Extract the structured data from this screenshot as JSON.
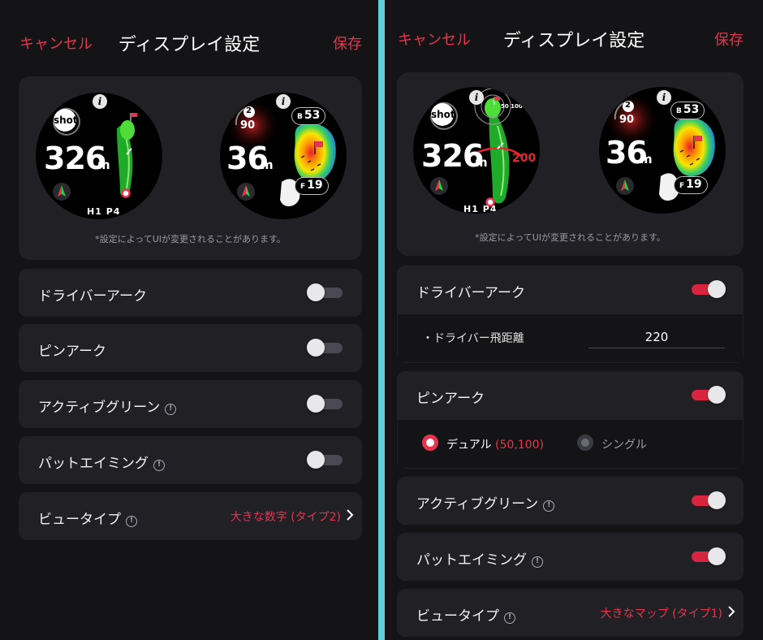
{
  "left": {
    "header": {
      "cancel": "キャンセル",
      "title": "ディスプレイ設定",
      "save": "保存"
    },
    "preview": {
      "note": "*設定によってUIが変更されることがあります。",
      "watch1": {
        "shot": "shot",
        "distance": "326",
        "unit": "m",
        "hole": "H1 P4"
      },
      "watch2": {
        "badge_num": "2",
        "yardage": "90",
        "distance": "36",
        "unit": "m",
        "back_prefix": "B",
        "back": "53",
        "front_prefix": "F",
        "front": "19"
      }
    },
    "rows": [
      {
        "label": "ドライバーアーク",
        "toggle": "off"
      },
      {
        "label": "ピンアーク",
        "toggle": "off"
      },
      {
        "label": "アクティブグリーン",
        "toggle": "off"
      },
      {
        "label": "パットエイミング",
        "toggle": "off"
      }
    ],
    "view_type": {
      "label": "ビュータイプ",
      "value": "大きな数字 (タイプ2)"
    }
  },
  "right": {
    "header": {
      "cancel": "キャンセル",
      "title": "ディスプレイ設定",
      "save": "保存"
    },
    "preview": {
      "note": "*設定によってUIが変更されることがあります。",
      "watch1": {
        "shot": "shot",
        "distance": "326",
        "unit": "m",
        "hole": "H1 P4",
        "arc_distance": "200",
        "pin_arc_label": "50 100"
      },
      "watch2": {
        "badge_num": "2",
        "yardage": "90",
        "distance": "36",
        "unit": "m",
        "back_prefix": "B",
        "back": "53",
        "front_prefix": "F",
        "front": "19"
      }
    },
    "driver_arc": {
      "label": "ドライバーアーク",
      "toggle": "on",
      "sub_label": "・ドライバー飛距離",
      "value": "220"
    },
    "pin_arc": {
      "label": "ピンアーク",
      "toggle": "on",
      "option_dual": "デュアル",
      "option_dual_detail": "(50,100)",
      "option_single": "シングル",
      "selected": "dual"
    },
    "active_green": {
      "label": "アクティブグリーン",
      "toggle": "on"
    },
    "putt_aiming": {
      "label": "パットエイミング",
      "toggle": "on"
    },
    "view_type": {
      "label": "ビュータイプ",
      "value": "大きなマップ (タイプ1)"
    }
  },
  "colors": {
    "accent": "#e8334e",
    "toggle_on": "#d8253f",
    "background": "#141416",
    "card": "#202025",
    "divider": "#5fd0dc"
  },
  "icons": {
    "info": "info-icon",
    "chevron": "chevron-right-icon",
    "shot": "shot-arrow-icon",
    "compass": "compass-icon",
    "flag": "flag-icon"
  }
}
